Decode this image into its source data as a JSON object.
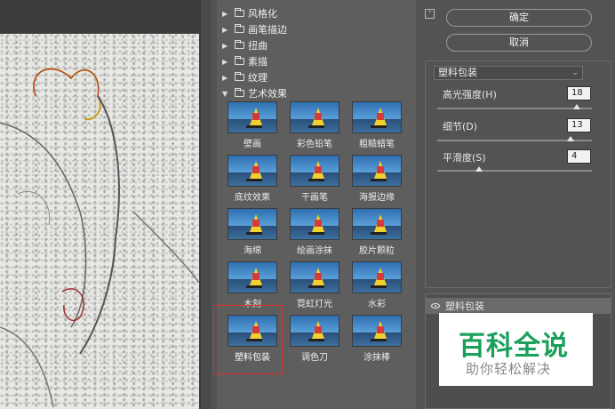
{
  "gallery": {
    "categories": [
      {
        "label": "风格化",
        "expanded": false
      },
      {
        "label": "画笔描边",
        "expanded": false
      },
      {
        "label": "扭曲",
        "expanded": false
      },
      {
        "label": "素描",
        "expanded": false
      },
      {
        "label": "纹理",
        "expanded": false
      },
      {
        "label": "艺术效果",
        "expanded": true
      }
    ],
    "thumbnails": [
      "壁画",
      "彩色铅笔",
      "粗糙蜡笔",
      "底纹效果",
      "干画笔",
      "海报边缘",
      "海绵",
      "绘画涂抹",
      "胶片颗粒",
      "木刻",
      "霓虹灯光",
      "水彩",
      "塑料包装",
      "调色刀",
      "涂抹棒"
    ],
    "selected": "塑料包装"
  },
  "controls": {
    "ok_label": "确定",
    "cancel_label": "取消",
    "filter_name": "塑料包装",
    "params": [
      {
        "label": "高光强度(H)",
        "value": "18",
        "fraction": 0.9
      },
      {
        "label": "细节(D)",
        "value": "13",
        "fraction": 0.86
      },
      {
        "label": "平滑度(S)",
        "value": "4",
        "fraction": 0.27
      }
    ]
  },
  "layers": {
    "active_layer": "塑料包装"
  },
  "watermark": {
    "title": "百科全说",
    "subtitle": "助你轻松解决"
  }
}
